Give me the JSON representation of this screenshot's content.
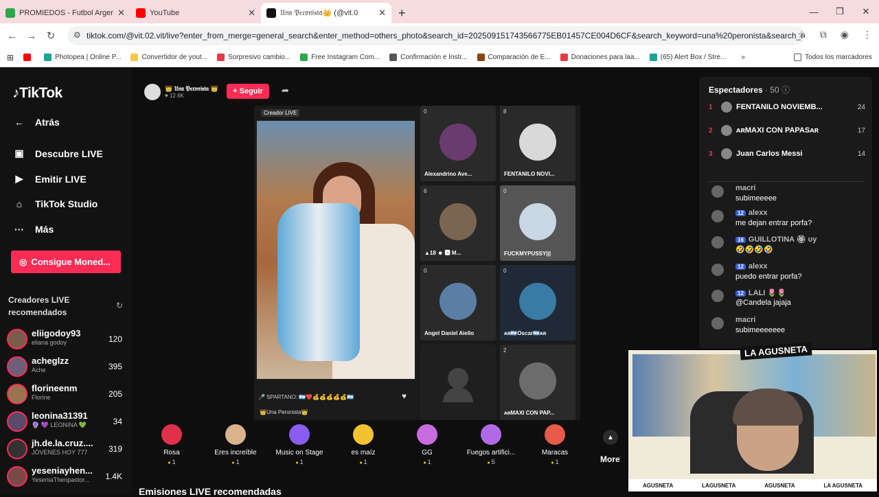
{
  "browser": {
    "tabs": [
      {
        "title": "PROMIEDOS - Futbol Argentino",
        "color": "#2aa84a"
      },
      {
        "title": "YouTube",
        "color": "#ff0000"
      },
      {
        "title": "𝔘𝔫𝔞 𝔓𝔢𝔯𝔬𝔫𝔦𝔰𝔱𝔞👑 (@vit.0",
        "color": "#111111"
      }
    ],
    "url": "tiktok.com/@vit.02.vit/live?enter_from_merge=general_search&enter_method=others_photo&search_id=20250915174356677​5EB01457CE004D6CF&search_keyword=una%20peronista&search_result_id...",
    "bookmarks": [
      {
        "label": "",
        "color": "#ff0000"
      },
      {
        "label": "Photopea | Online P...",
        "color": "#18a497"
      },
      {
        "label": "Convertidor de yout...",
        "color": "#f2c94c"
      },
      {
        "label": "Sorpresivo cambio...",
        "color": "#e63946"
      },
      {
        "label": "Free Instagram Com...",
        "color": "#2aa84a"
      },
      {
        "label": "Confirmación e Instr...",
        "color": "#555555"
      },
      {
        "label": "Comparación de E...",
        "color": "#8b4513"
      },
      {
        "label": "Donaciones para laa...",
        "color": "#e63946"
      },
      {
        "label": "(65) Alert Box / Stre...",
        "color": "#18a497"
      }
    ],
    "all_bookmarks": "Todos los marcadores"
  },
  "sidebar": {
    "logo": "TikTok",
    "nav": [
      {
        "label": "Atrás",
        "icon": "←"
      },
      {
        "label": "Descubre LIVE",
        "icon": "▣"
      },
      {
        "label": "Emitir LIVE",
        "icon": "▶"
      },
      {
        "label": "TikTok Studio",
        "icon": "⌂"
      },
      {
        "label": "Más",
        "icon": "···"
      }
    ],
    "coins_button": "Consigue Moned...",
    "recommended_header": "Creadores LIVE recomendados",
    "creators": [
      {
        "name": "eliigodoy93",
        "sub": "eliana godoy",
        "count": "120"
      },
      {
        "name": "acheglzz",
        "sub": "Ache",
        "count": "395"
      },
      {
        "name": "florineenm",
        "sub": "Florine",
        "count": "205"
      },
      {
        "name": "leonina31391",
        "sub": "🔮 💜 LEONINA 💚",
        "count": "34"
      },
      {
        "name": "jh.de.la.cruz....",
        "sub": "JÓVENES HOY 777",
        "count": "319"
      },
      {
        "name": "yeseniayhen...",
        "sub": "YeseniaThenpastor...",
        "count": "1.4K"
      }
    ]
  },
  "host": {
    "name": "👑 𝔘𝔫𝔞 𝔓𝔢𝔯𝔬𝔫𝔦𝔰𝔱𝔞 👑",
    "likes": "♥ 12.6K",
    "follow": "+ Seguir"
  },
  "stage": {
    "main_label": "Creador LIVE",
    "main_caption": "🎤 SPARTANO: 🇦🇷❤️💰💰💰💰💰🇦🇷",
    "main_name": "👑Una Peronista👑",
    "guests": [
      {
        "count": "0",
        "name": "Alexandrino Ave...",
        "color": "#6a3b6e"
      },
      {
        "count": "8",
        "name": "FENTANILO NOVI...",
        "color": "#d9d9d9"
      },
      {
        "count": "6",
        "name": "▲18 ☻ 🅰 M...",
        "color": "#7a6650"
      },
      {
        "count": "0",
        "name": "FUCKMYPUSSY|||",
        "color": "#c9d6e4"
      },
      {
        "count": "0",
        "name": "Angel Daniel Aiello",
        "color": "#5b7ea4"
      },
      {
        "count": "0",
        "name": "ᴀʀ🇦🇷Oscar🇦🇷ᴀʀ",
        "color": "#3a7ba6"
      },
      {
        "count": "",
        "name": "",
        "color": "#2a2a2a"
      },
      {
        "count": "2",
        "name": "ᴀʀMAXI CON PAP...",
        "color": "#6c6c6c"
      }
    ]
  },
  "gifts": [
    {
      "name": "Rosa",
      "price": "1",
      "color": "#e0304a"
    },
    {
      "name": "Eres increíble",
      "price": "1",
      "color": "#d9b38c"
    },
    {
      "name": "Music on Stage",
      "price": "1",
      "color": "#8a5cf0"
    },
    {
      "name": "es maíz",
      "price": "1",
      "color": "#f2c230"
    },
    {
      "name": "GG",
      "price": "1",
      "color": "#c86de0"
    },
    {
      "name": "Fuegos artifici...",
      "price": "5",
      "color": "#b06ae8"
    },
    {
      "name": "Maracas",
      "price": "1",
      "color": "#e85a4a"
    }
  ],
  "more_label": "More",
  "recommended_live": "Emisiones LIVE recomendadas",
  "viewers": {
    "title": "Espectadores",
    "count": "· 50",
    "top": [
      {
        "rank": "1",
        "name": "FENTANILO NOVIEMB...",
        "score": "24"
      },
      {
        "rank": "2",
        "name": "ᴀʀMAXI CON PAPASᴀʀ",
        "score": "17"
      },
      {
        "rank": "3",
        "name": "Juan Carlos Messi",
        "score": "14"
      }
    ]
  },
  "chat": [
    {
      "user": "macri",
      "badge": "",
      "msg": "subimeeeee"
    },
    {
      "user": "alexx",
      "badge": "12",
      "msg": "me dejan entrar porfa?"
    },
    {
      "user": "GUILLOTINA 🏵 υу",
      "badge": "16",
      "msg": "🤣🤣🤣🤣"
    },
    {
      "user": "alexx",
      "badge": "12",
      "msg": "puedo entrar porfa?"
    },
    {
      "user": "LALI 🌷🌷",
      "badge": "12",
      "msg": "@Candela jajaja"
    },
    {
      "user": "macri",
      "badge": "",
      "msg": "subimeeeeeee"
    }
  ],
  "webcam": {
    "title": "LA AGUSNETA",
    "socials": [
      "AGUSNETA",
      "LAGUSNETA",
      "AGUSNETA",
      "LA AGUSNETA"
    ]
  }
}
